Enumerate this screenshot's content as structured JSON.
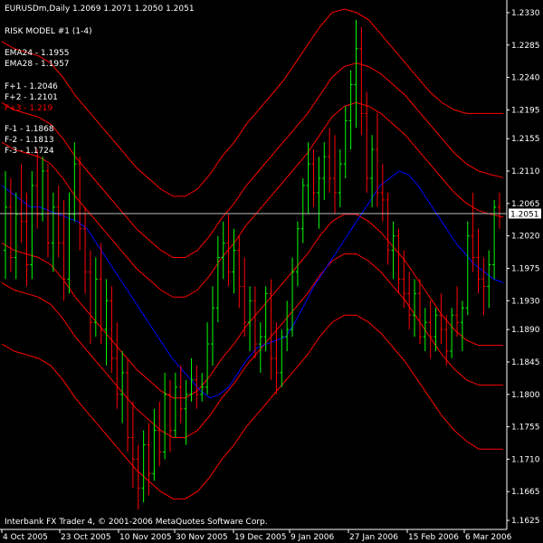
{
  "header": {
    "symbol_line": "EURUSDm,Daily  1.2069 1.2071 1.2050 1.2051",
    "model": "RISK MODEL #1 (1-4)"
  },
  "indicators": {
    "ema24": "EMA24 - 1.1955",
    "ema28": "EMA28 - 1.1957",
    "f_plus_1": "F+1 - 1.2046",
    "f_plus_2": "F+2 - 1.2101",
    "f_plus_3": "F+3 - 1.219",
    "f_minus_1": "F-1 - 1.1868",
    "f_minus_2": "F-2 - 1.1813",
    "f_minus_3": "F-3 - 1.1724"
  },
  "footer": {
    "copyright": "Interbank FX Trader 4, © 2001-2006 MetaQuotes Software Corp."
  },
  "colors": {
    "background": "#000000",
    "axis_text": "#ffffff",
    "up_bar": "#00ff00",
    "down_bar": "#ff0000",
    "band": "#ff0000",
    "ema": "#0000ff",
    "ema_alt": "#008000",
    "bid_line": "#c0c0c0",
    "price_label_bg": "#ffffff",
    "price_label_fg": "#000000",
    "f_plus_3_color": "#ff0000"
  },
  "chart_data": {
    "type": "line",
    "title": "EURUSDm,Daily  1.2069 1.2071 1.2050 1.2051",
    "subtitle": "RISK MODEL #1 (1-4)",
    "x_ticks": [
      "4 Oct 2005",
      "23 Oct 2005",
      "10 Nov 2005",
      "30 Nov 2005",
      "19 Dec 2005",
      "9 Jan 2006",
      "27 Jan 2006",
      "15 Feb 2006",
      "6 Mar 2006"
    ],
    "y_ticks": [
      "1.2330",
      "1.2285",
      "1.2240",
      "1.2195",
      "1.2155",
      "1.2110",
      "1.2065",
      "1.2020",
      "1.1975",
      "1.1930",
      "1.1890",
      "1.1845",
      "1.1800",
      "1.1755",
      "1.1710",
      "1.1665",
      "1.1625"
    ],
    "ylim": [
      1.1615,
      1.2345
    ],
    "current_price": "1.2051",
    "grid": false,
    "bars": [
      [
        1.2,
        1.211,
        1.196,
        1.206
      ],
      [
        1.206,
        1.21,
        1.197,
        1.199
      ],
      [
        1.199,
        1.208,
        1.196,
        1.205
      ],
      [
        1.205,
        1.212,
        1.201,
        1.204
      ],
      [
        1.204,
        1.208,
        1.195,
        1.198
      ],
      [
        1.198,
        1.211,
        1.196,
        1.209
      ],
      [
        1.209,
        1.214,
        1.203,
        1.205
      ],
      [
        1.205,
        1.213,
        1.204,
        1.211
      ],
      [
        1.211,
        1.212,
        1.199,
        1.201
      ],
      [
        1.201,
        1.208,
        1.197,
        1.206
      ],
      [
        1.206,
        1.209,
        1.199,
        1.201
      ],
      [
        1.201,
        1.207,
        1.193,
        1.196
      ],
      [
        1.196,
        1.208,
        1.194,
        1.205
      ],
      [
        1.205,
        1.215,
        1.204,
        1.212
      ],
      [
        1.212,
        1.213,
        1.2,
        1.203
      ],
      [
        1.203,
        1.206,
        1.194,
        1.197
      ],
      [
        1.197,
        1.2,
        1.187,
        1.19
      ],
      [
        1.19,
        1.199,
        1.188,
        1.196
      ],
      [
        1.196,
        1.201,
        1.187,
        1.189
      ],
      [
        1.189,
        1.196,
        1.184,
        1.193
      ],
      [
        1.193,
        1.195,
        1.183,
        1.185
      ],
      [
        1.185,
        1.19,
        1.178,
        1.18
      ],
      [
        1.18,
        1.186,
        1.176,
        1.183
      ],
      [
        1.183,
        1.185,
        1.172,
        1.174
      ],
      [
        1.174,
        1.179,
        1.167,
        1.171
      ],
      [
        1.171,
        1.173,
        1.164,
        1.167
      ],
      [
        1.167,
        1.175,
        1.165,
        1.173
      ],
      [
        1.173,
        1.176,
        1.166,
        1.169
      ],
      [
        1.169,
        1.178,
        1.168,
        1.175
      ],
      [
        1.175,
        1.179,
        1.17,
        1.172
      ],
      [
        1.172,
        1.183,
        1.171,
        1.18
      ],
      [
        1.18,
        1.182,
        1.172,
        1.175
      ],
      [
        1.175,
        1.183,
        1.174,
        1.181
      ],
      [
        1.181,
        1.184,
        1.176,
        1.178
      ],
      [
        1.178,
        1.182,
        1.173,
        1.18
      ],
      [
        1.18,
        1.185,
        1.179,
        1.182
      ],
      [
        1.182,
        1.184,
        1.178,
        1.18
      ],
      [
        1.18,
        1.183,
        1.179,
        1.181
      ],
      [
        1.181,
        1.19,
        1.18,
        1.187
      ],
      [
        1.187,
        1.195,
        1.184,
        1.192
      ],
      [
        1.192,
        1.202,
        1.19,
        1.199
      ],
      [
        1.199,
        1.204,
        1.196,
        1.201
      ],
      [
        1.201,
        1.205,
        1.195,
        1.197
      ],
      [
        1.197,
        1.203,
        1.194,
        1.2
      ],
      [
        1.2,
        1.202,
        1.192,
        1.195
      ],
      [
        1.195,
        1.199,
        1.188,
        1.19
      ],
      [
        1.19,
        1.195,
        1.186,
        1.193
      ],
      [
        1.193,
        1.195,
        1.185,
        1.187
      ],
      [
        1.187,
        1.19,
        1.183,
        1.188
      ],
      [
        1.188,
        1.195,
        1.186,
        1.194
      ],
      [
        1.194,
        1.196,
        1.182,
        1.185
      ],
      [
        1.185,
        1.19,
        1.18,
        1.183
      ],
      [
        1.183,
        1.189,
        1.181,
        1.188
      ],
      [
        1.188,
        1.193,
        1.186,
        1.189
      ],
      [
        1.189,
        1.199,
        1.188,
        1.197
      ],
      [
        1.197,
        1.204,
        1.195,
        1.203
      ],
      [
        1.203,
        1.21,
        1.201,
        1.209
      ],
      [
        1.209,
        1.215,
        1.205,
        1.212
      ],
      [
        1.212,
        1.214,
        1.206,
        1.208
      ],
      [
        1.208,
        1.213,
        1.203,
        1.21
      ],
      [
        1.21,
        1.215,
        1.207,
        1.213
      ],
      [
        1.213,
        1.217,
        1.208,
        1.21
      ],
      [
        1.21,
        1.216,
        1.205,
        1.208
      ],
      [
        1.208,
        1.214,
        1.206,
        1.212
      ],
      [
        1.212,
        1.22,
        1.21,
        1.218
      ],
      [
        1.218,
        1.225,
        1.214,
        1.223
      ],
      [
        1.223,
        1.232,
        1.217,
        1.228
      ],
      [
        1.228,
        1.231,
        1.216,
        1.219
      ],
      [
        1.219,
        1.222,
        1.208,
        1.21
      ],
      [
        1.21,
        1.216,
        1.206,
        1.214
      ],
      [
        1.214,
        1.219,
        1.206,
        1.208
      ],
      [
        1.208,
        1.212,
        1.204,
        1.207
      ],
      [
        1.207,
        1.208,
        1.198,
        1.2
      ],
      [
        1.2,
        1.204,
        1.196,
        1.202
      ],
      [
        1.202,
        1.203,
        1.194,
        1.196
      ],
      [
        1.196,
        1.2,
        1.192,
        1.194
      ],
      [
        1.194,
        1.197,
        1.189,
        1.191
      ],
      [
        1.191,
        1.196,
        1.188,
        1.194
      ],
      [
        1.194,
        1.196,
        1.187,
        1.188
      ],
      [
        1.188,
        1.192,
        1.186,
        1.19
      ],
      [
        1.19,
        1.193,
        1.185,
        1.188
      ],
      [
        1.188,
        1.192,
        1.186,
        1.191
      ],
      [
        1.191,
        1.194,
        1.187,
        1.189
      ],
      [
        1.189,
        1.191,
        1.184,
        1.186
      ],
      [
        1.186,
        1.192,
        1.185,
        1.191
      ],
      [
        1.191,
        1.195,
        1.188,
        1.19
      ],
      [
        1.19,
        1.193,
        1.186,
        1.192
      ],
      [
        1.192,
        1.204,
        1.191,
        1.202
      ],
      [
        1.202,
        1.208,
        1.197,
        1.199
      ],
      [
        1.199,
        1.203,
        1.194,
        1.196
      ],
      [
        1.196,
        1.199,
        1.191,
        1.195
      ],
      [
        1.195,
        1.2,
        1.192,
        1.198
      ],
      [
        1.198,
        1.207,
        1.196,
        1.206
      ],
      [
        1.206,
        1.208,
        1.203,
        1.2051
      ]
    ],
    "series": [
      {
        "name": "EMA24",
        "color": "#0000ff",
        "values": [
          1.209,
          1.208,
          1.207,
          1.206,
          1.206,
          1.2055,
          1.205,
          1.2045,
          1.204,
          1.203,
          1.201,
          1.199,
          1.197,
          1.195,
          1.193,
          1.191,
          1.189,
          1.187,
          1.185,
          1.1835,
          1.182,
          1.1805,
          1.1795,
          1.18,
          1.181,
          1.183,
          1.185,
          1.1865,
          1.187,
          1.1875,
          1.188,
          1.19,
          1.1925,
          1.195,
          1.197,
          1.199,
          1.201,
          1.203,
          1.205,
          1.207,
          1.209,
          1.21,
          1.211,
          1.2105,
          1.209,
          1.207,
          1.205,
          1.203,
          1.201,
          1.1995,
          1.198,
          1.197,
          1.196,
          1.1955
        ]
      },
      {
        "name": "F+1",
        "color": "#ff0000",
        "values": [
          1.215,
          1.214,
          1.2135,
          1.213,
          1.212,
          1.21,
          1.2075,
          1.2055,
          1.2035,
          1.2015,
          1.1995,
          1.1975,
          1.196,
          1.1945,
          1.1935,
          1.1935,
          1.1945,
          1.1965,
          1.199,
          1.201,
          1.2035,
          1.2055,
          1.2075,
          1.2095,
          1.2115,
          1.2135,
          1.216,
          1.2185,
          1.22,
          1.2205,
          1.22,
          1.219,
          1.2175,
          1.216,
          1.214,
          1.212,
          1.21,
          1.208,
          1.2065,
          1.2055,
          1.205,
          1.2046
        ]
      },
      {
        "name": "F+2",
        "color": "#ff0000",
        "values": [
          1.2205,
          1.2195,
          1.219,
          1.2185,
          1.2175,
          1.2155,
          1.213,
          1.211,
          1.209,
          1.207,
          1.205,
          1.203,
          1.2015,
          1.2,
          1.199,
          1.199,
          1.2,
          1.202,
          1.2045,
          1.2065,
          1.209,
          1.211,
          1.213,
          1.215,
          1.217,
          1.219,
          1.2215,
          1.224,
          1.2255,
          1.226,
          1.2255,
          1.2245,
          1.223,
          1.2215,
          1.2195,
          1.2175,
          1.2155,
          1.2135,
          1.212,
          1.211,
          1.2105,
          1.2101
        ]
      },
      {
        "name": "F+3",
        "color": "#ff0000",
        "values": [
          1.229,
          1.228,
          1.2275,
          1.227,
          1.226,
          1.224,
          1.2215,
          1.2195,
          1.2175,
          1.2155,
          1.2135,
          1.2115,
          1.21,
          1.2085,
          1.2075,
          1.2075,
          1.2085,
          1.2105,
          1.213,
          1.215,
          1.2175,
          1.2195,
          1.2215,
          1.2235,
          1.226,
          1.2285,
          1.231,
          1.233,
          1.2335,
          1.233,
          1.232,
          1.23,
          1.228,
          1.226,
          1.224,
          1.222,
          1.2205,
          1.2195,
          1.219,
          1.219,
          1.219,
          1.219
        ]
      },
      {
        "name": "F-1",
        "color": "#ff0000",
        "values": [
          1.201,
          1.2,
          1.1995,
          1.199,
          1.198,
          1.196,
          1.1935,
          1.1915,
          1.1895,
          1.1875,
          1.1855,
          1.1835,
          1.182,
          1.1805,
          1.1795,
          1.1795,
          1.1805,
          1.1825,
          1.185,
          1.187,
          1.1895,
          1.1915,
          1.1935,
          1.1955,
          1.1975,
          1.1995,
          1.202,
          1.204,
          1.205,
          1.205,
          1.204,
          1.2025,
          1.2005,
          1.1985,
          1.196,
          1.1935,
          1.191,
          1.189,
          1.1875,
          1.1868,
          1.1868,
          1.1868
        ]
      },
      {
        "name": "F-2",
        "color": "#ff0000",
        "values": [
          1.1955,
          1.1945,
          1.194,
          1.1935,
          1.1925,
          1.1905,
          1.188,
          1.186,
          1.184,
          1.182,
          1.18,
          1.178,
          1.1765,
          1.175,
          1.174,
          1.174,
          1.175,
          1.177,
          1.1795,
          1.1815,
          1.184,
          1.186,
          1.188,
          1.19,
          1.192,
          1.194,
          1.1965,
          1.1985,
          1.1995,
          1.1995,
          1.1985,
          1.197,
          1.195,
          1.193,
          1.1905,
          1.188,
          1.1855,
          1.1835,
          1.182,
          1.1813,
          1.1813,
          1.1813
        ]
      },
      {
        "name": "F-3",
        "color": "#ff0000",
        "values": [
          1.187,
          1.186,
          1.1855,
          1.185,
          1.184,
          1.182,
          1.1795,
          1.1775,
          1.1755,
          1.1735,
          1.1715,
          1.1695,
          1.168,
          1.1665,
          1.1655,
          1.1655,
          1.1665,
          1.1685,
          1.171,
          1.173,
          1.1755,
          1.1775,
          1.1795,
          1.1815,
          1.1835,
          1.1855,
          1.188,
          1.19,
          1.191,
          1.191,
          1.19,
          1.1885,
          1.1865,
          1.1845,
          1.182,
          1.1795,
          1.177,
          1.175,
          1.1735,
          1.1724,
          1.1724,
          1.1724
        ]
      }
    ]
  }
}
